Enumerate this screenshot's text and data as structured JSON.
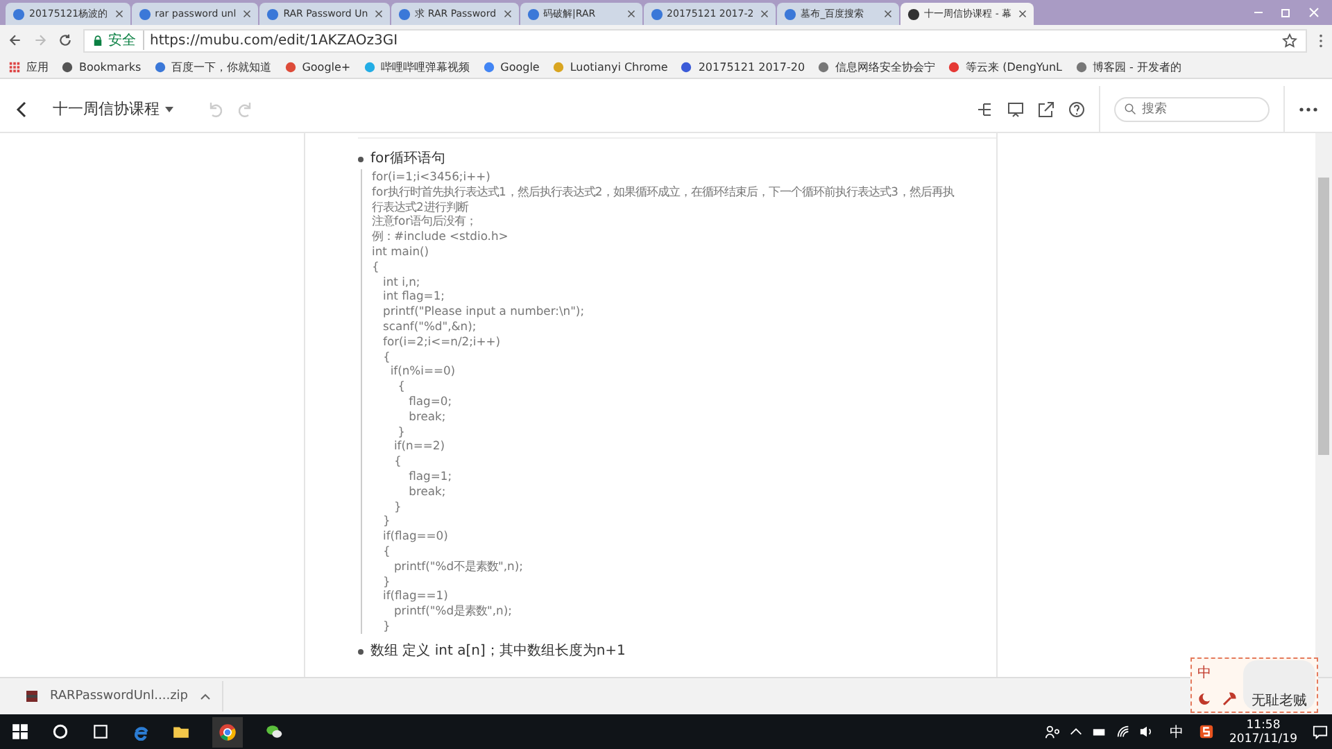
{
  "browser": {
    "tabs": [
      {
        "title": "20175121杨波的",
        "selected": false
      },
      {
        "title": "rar password unl",
        "selected": false
      },
      {
        "title": "RAR Password Un",
        "selected": false
      },
      {
        "title": "求 RAR Password",
        "selected": false
      },
      {
        "title": "码破解|RAR",
        "selected": false
      },
      {
        "title": "20175121 2017-2",
        "selected": false
      },
      {
        "title": "墓布_百度搜索",
        "selected": false
      },
      {
        "title": "十一周信协课程 - 幕",
        "selected": true
      }
    ],
    "security_label": "安全",
    "url": "https://mubu.com/edit/1AKZAOz3GI",
    "bookmarks": [
      "应用",
      "Bookmarks",
      "百度一下，你就知道",
      "Google+",
      "哔哩哔哩弹幕视频",
      "Google",
      "Luotianyi Chrome",
      "20175121 2017-20",
      "信息网络安全协会宁",
      "等云来 (DengYunL",
      "博客园 - 开发者的"
    ]
  },
  "app": {
    "doc_title": "十一周信协课程",
    "search": {
      "placeholder": "搜索"
    }
  },
  "outline": [
    {
      "text": "for循环语句",
      "note": [
        "for(i=1;i<3456;i++)",
        "for执行时首先执行表达式1，然后执行表达式2，如果循环成立，在循环结束后，下一个循环前执行表达式3，然后再执行表达式2进行判断",
        "注意for语句后没有；",
        "例：#include <stdio.h>",
        "int main()",
        "{",
        "   int i,n;",
        "   int flag=1;",
        "   printf(\"Please input a number:\\n\");",
        "   scanf(\"%d\",&n);",
        "   for(i=2;i<=n/2;i++)",
        "   {",
        "     if(n%i==0)",
        "       {",
        "          flag=0;",
        "          break;",
        "       }",
        "      if(n==2)",
        "      {",
        "          flag=1;",
        "          break;",
        "      }",
        "   }",
        "   if(flag==0)",
        "   {",
        "      printf(\"%d不是素数\",n);",
        "   }",
        "   if(flag==1)",
        "      printf(\"%d是素数\",n);",
        "   }"
      ]
    },
    {
      "text": "数组 定义 int a[n]；其中数组长度为n+1"
    }
  ],
  "download": {
    "file": "RARPasswordUnl....zip"
  },
  "ime": {
    "mode": "中",
    "sticker_caption": "无耻老贼"
  },
  "taskbar": {
    "ime_indicator": "中",
    "time": "11:58",
    "date": "2017/11/19"
  }
}
